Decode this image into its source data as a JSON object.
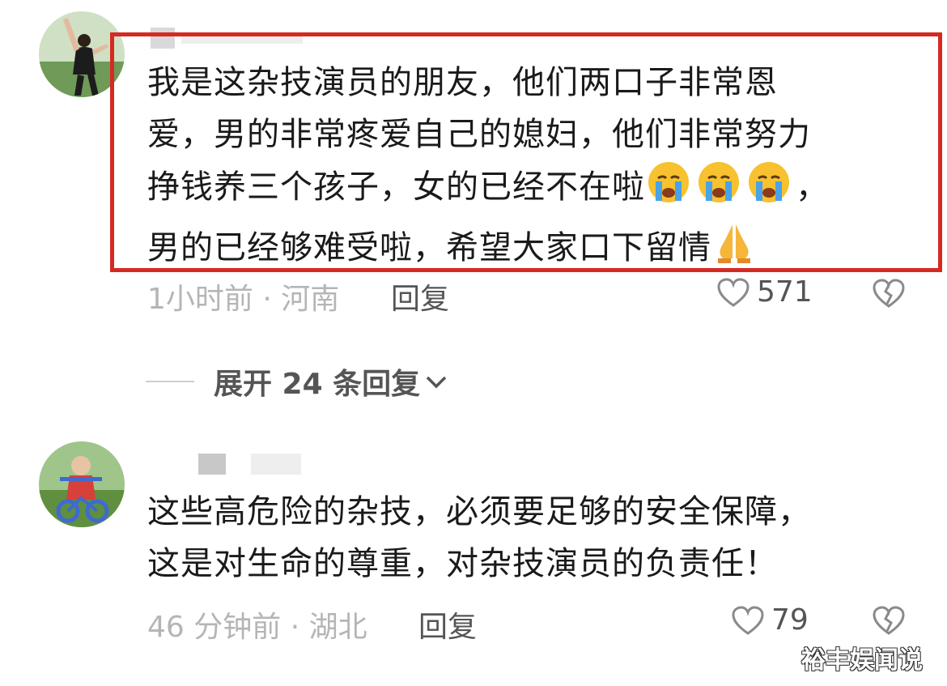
{
  "comments": [
    {
      "text_lines": [
        "我是这杂技演员的朋友，他们两口子非常恩",
        "爱，男的非常疼爱自己的媳妇，他们非常努力",
        "挣钱养三个孩子，女的已经不在啦",
        "，",
        "男的已经够难受啦，希望大家口下留情"
      ],
      "emojis": [
        "crying-emoji",
        "crying-emoji",
        "crying-emoji",
        "praying-hands-emoji"
      ],
      "meta": "1小时前 · 河南",
      "reply_label": "回复",
      "likes": "571"
    },
    {
      "text_lines": [
        "这些高危险的杂技，必须要足够的安全保障，",
        "这是对生命的尊重，对杂技演员的负责任！"
      ],
      "meta": "46 分钟前 · 湖北",
      "reply_label": "回复",
      "likes": "79"
    }
  ],
  "expand_replies": "展开 24 条回复",
  "watermark": "裕丰娱闻说",
  "colors": {
    "highlight": "#d42a22",
    "meta": "#b5b5b5"
  }
}
